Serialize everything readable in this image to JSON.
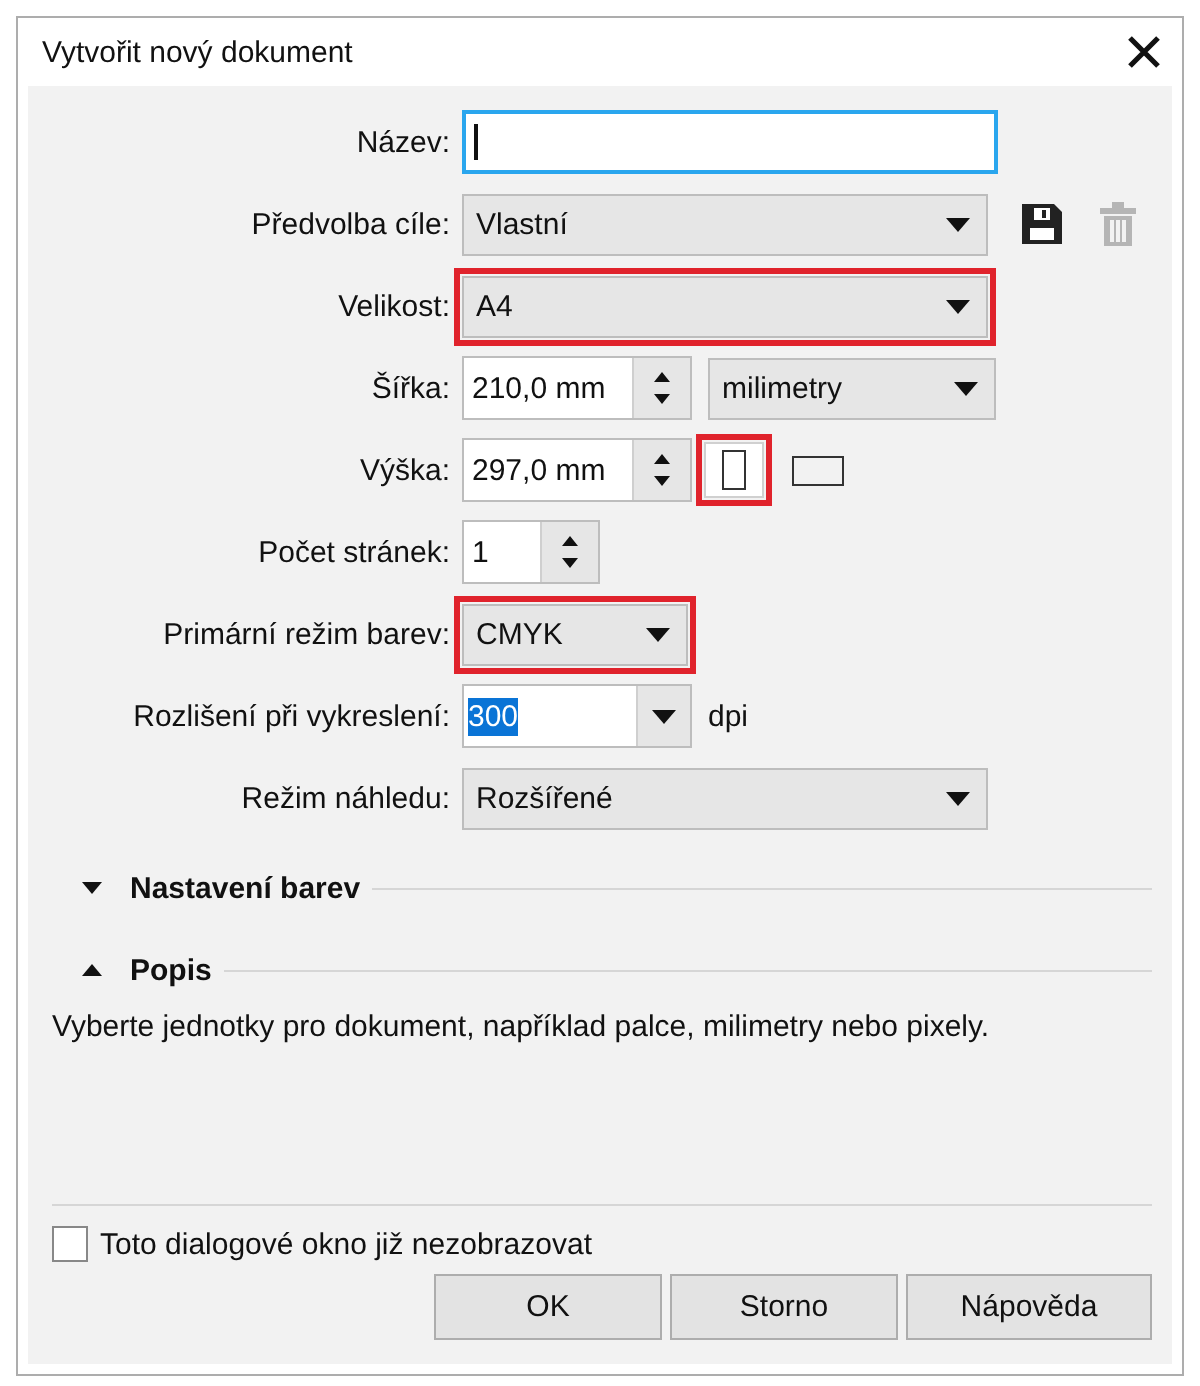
{
  "window": {
    "title": "Vytvořit nový dokument"
  },
  "form": [
    {
      "kind": "text",
      "label": "Název:",
      "focused": true
    },
    {
      "kind": "select",
      "label": "Předvolba cíle:",
      "value": "Vlastní",
      "highlighted": false,
      "save_disabled": false,
      "delete_disabled": true
    },
    {
      "kind": "select",
      "label": "Velikost:",
      "value": "A4",
      "highlighted": true
    },
    {
      "kind": "spin",
      "label": "Šířka:",
      "value": "210,0 mm",
      "unit": "milimetry"
    },
    {
      "kind": "spin",
      "label": "Výška:",
      "value": "297,0 mm",
      "orientation": [
        {
          "selected": true,
          "highlighted": true
        },
        {
          "selected": false,
          "highlighted": false
        }
      ]
    },
    {
      "kind": "spin_small",
      "label": "Počet stránek:",
      "value": "1"
    },
    {
      "kind": "select_small",
      "label": "Primární režim barev:",
      "value": "CMYK",
      "highlighted": true
    },
    {
      "kind": "combo",
      "label": "Rozlišení při vykreslení:",
      "value": "300",
      "value_selected": true,
      "suffix": "dpi"
    },
    {
      "kind": "select",
      "label": "Režim náhledu:",
      "value": "Rozšířené",
      "highlighted": false
    }
  ],
  "sections": [
    {
      "title": "Nastavení barev",
      "expanded": false
    },
    {
      "title": "Popis",
      "expanded": true,
      "text": "Vyberte jednotky pro dokument, například palce, milimetry nebo pixely."
    }
  ],
  "checkbox": {
    "label": "Toto dialogové okno již nezobrazovat",
    "checked": false
  },
  "buttons": [
    {
      "label": "OK"
    },
    {
      "label": "Storno"
    },
    {
      "label": "Nápověda"
    }
  ]
}
